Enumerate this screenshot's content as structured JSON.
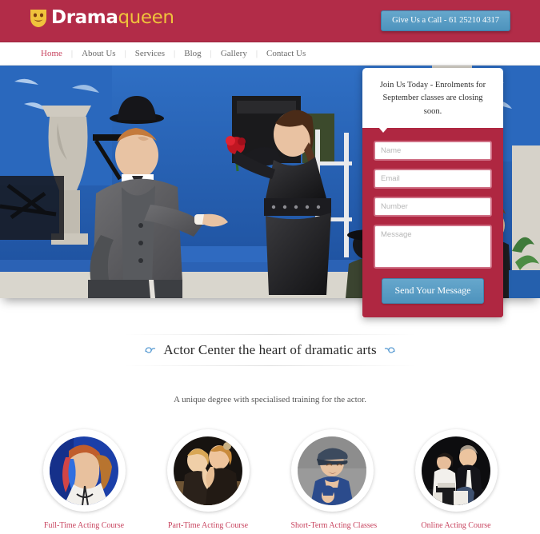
{
  "colors": {
    "header_red": "#b22c48",
    "panel_red": "#af2741",
    "accent_blue": "#5296c0",
    "logo_gold": "#f0c23c",
    "link_pink": "#c8445f"
  },
  "header": {
    "logo": {
      "primary": "Drama",
      "secondary": "queen",
      "icon": "theater-mask-icon"
    },
    "call_button": "Give Us a Call - 61 25210 4317"
  },
  "nav": {
    "items": [
      {
        "label": "Home",
        "active": true
      },
      {
        "label": "About Us",
        "active": false
      },
      {
        "label": "Services",
        "active": false
      },
      {
        "label": "Blog",
        "active": false
      },
      {
        "label": "Gallery",
        "active": false
      },
      {
        "label": "Contact Us",
        "active": false
      }
    ]
  },
  "form": {
    "heading": "Join Us Today - Enrolments for September classes are closing soon.",
    "fields": [
      {
        "name": "name",
        "placeholder": "Name",
        "value": ""
      },
      {
        "name": "email",
        "placeholder": "Email",
        "value": ""
      },
      {
        "name": "number",
        "placeholder": "Number",
        "value": ""
      },
      {
        "name": "message",
        "placeholder": "Message",
        "value": ""
      }
    ],
    "submit_label": "Send Your Message"
  },
  "section": {
    "title": "Actor Center the heart of dramatic arts",
    "subtitle": "A unique degree with specialised training for the actor.",
    "ornament_icon": "swirl-flourish-icon"
  },
  "courses": [
    {
      "label": "Full-Time Acting Course",
      "image": "actress-with-face-paint"
    },
    {
      "label": "Part-Time Acting Course",
      "image": "two-actors-rehearsing"
    },
    {
      "label": "Short-Term Acting Classes",
      "image": "man-in-flat-cap"
    },
    {
      "label": "Online Acting Course",
      "image": "seated-performers-on-stage"
    }
  ]
}
